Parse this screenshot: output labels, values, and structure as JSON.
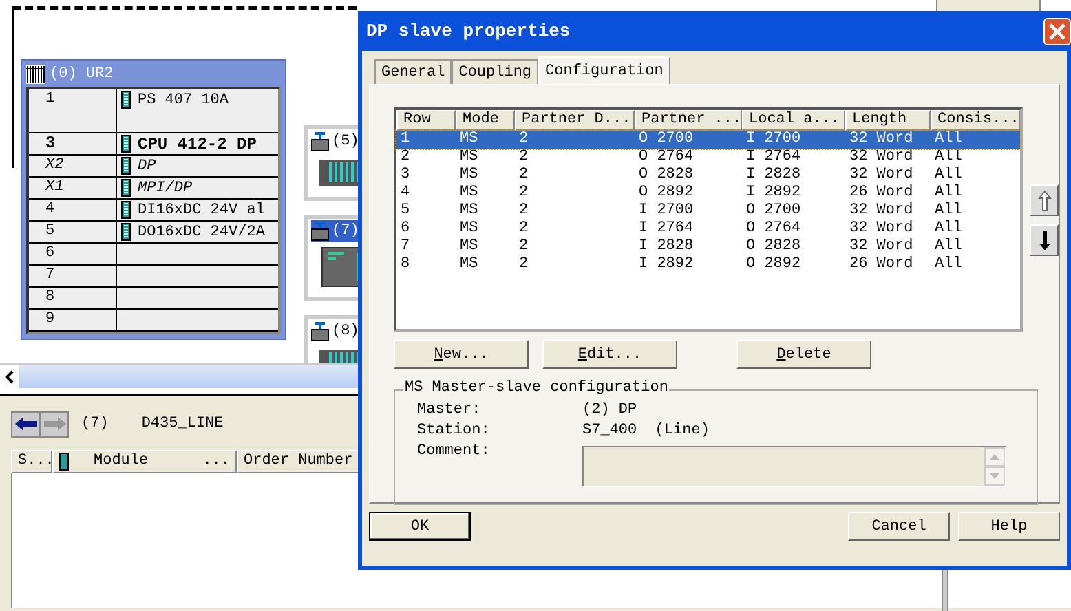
{
  "background": {
    "rack": {
      "title": "(0) UR2",
      "slots": [
        {
          "slot": "1",
          "module": "PS 407 10A",
          "kind": "power"
        },
        {
          "slot": "3",
          "module": "CPU 412-2 DP",
          "kind": "cpu"
        },
        {
          "slot": "X2",
          "module": "DP",
          "kind": "interface"
        },
        {
          "slot": "X1",
          "module": "MPI/DP",
          "kind": "interface"
        },
        {
          "slot": "4",
          "module": "DI16xDC 24V al",
          "kind": "module"
        },
        {
          "slot": "5",
          "module": "DO16xDC 24V/2A",
          "kind": "module"
        },
        {
          "slot": "6",
          "kind": "empty"
        },
        {
          "slot": "7",
          "kind": "empty"
        },
        {
          "slot": "8",
          "kind": "empty"
        },
        {
          "slot": "9",
          "kind": "empty"
        }
      ]
    },
    "stations": [
      {
        "label": "(5)",
        "selected": false,
        "kind": "io-rack"
      },
      {
        "label": "(7)",
        "selected": true,
        "kind": "cpu"
      },
      {
        "label": "(8)",
        "selected": false,
        "kind": "io-rack"
      }
    ],
    "detail": {
      "station_number": "(7)",
      "station_name": "D435_LINE",
      "columns": [
        {
          "label": "S...",
          "kind": "text"
        },
        {
          "label": "Module",
          "kind": "module"
        },
        {
          "label": "Order Number",
          "kind": "text"
        }
      ],
      "module_column_suffix": "..."
    }
  },
  "dialog": {
    "title": "DP slave properties",
    "tabs": [
      {
        "label": "General",
        "selected": false
      },
      {
        "label": "Coupling",
        "selected": false
      },
      {
        "label": "Configuration",
        "selected": true
      }
    ],
    "table": {
      "columns": [
        "Row",
        "Mode",
        "Partner D...",
        "Partner ...",
        "Local a...",
        "Length",
        "Consis..."
      ],
      "rows": [
        {
          "cells": [
            "1",
            "MS",
            "2",
            "O 2700",
            "I 2700",
            "32 Word",
            "All"
          ],
          "selected": true
        },
        {
          "cells": [
            "2",
            "MS",
            "2",
            "O 2764",
            "I 2764",
            "32 Word",
            "All"
          ],
          "selected": false
        },
        {
          "cells": [
            "3",
            "MS",
            "2",
            "O 2828",
            "I 2828",
            "32 Word",
            "All"
          ],
          "selected": false
        },
        {
          "cells": [
            "4",
            "MS",
            "2",
            "O 2892",
            "I 2892",
            "26 Word",
            "All"
          ],
          "selected": false
        },
        {
          "cells": [
            "5",
            "MS",
            "2",
            "I 2700",
            "O 2700",
            "32 Word",
            "All"
          ],
          "selected": false
        },
        {
          "cells": [
            "6",
            "MS",
            "2",
            "I 2764",
            "O 2764",
            "32 Word",
            "All"
          ],
          "selected": false
        },
        {
          "cells": [
            "7",
            "MS",
            "2",
            "I 2828",
            "O 2828",
            "32 Word",
            "All"
          ],
          "selected": false
        },
        {
          "cells": [
            "8",
            "MS",
            "2",
            "I 2892",
            "O 2892",
            "26 Word",
            "All"
          ],
          "selected": false
        }
      ]
    },
    "actions": [
      "New...",
      "Edit...",
      "Delete"
    ],
    "group": {
      "title": "MS Master-slave configuration",
      "fields": [
        {
          "label": "Master:",
          "value": "(2) DP"
        },
        {
          "label": "Station:",
          "value": "S7_400  (Line)"
        }
      ],
      "comment_label": "Comment:"
    },
    "footer_left": [
      "OK"
    ],
    "footer_right": [
      "Cancel",
      "Help"
    ]
  }
}
